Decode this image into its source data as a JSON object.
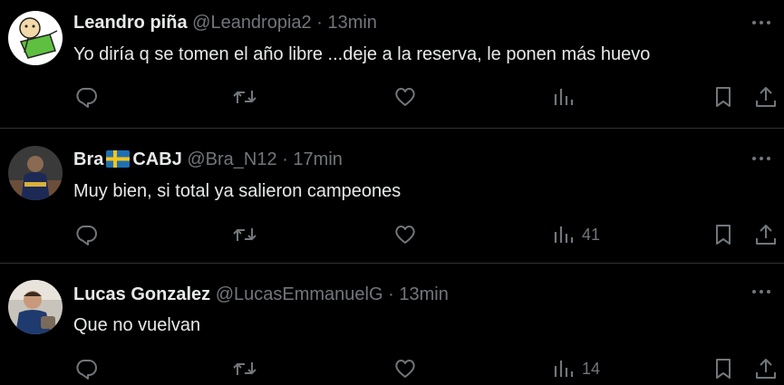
{
  "colors": {
    "background": "#000000",
    "text_primary": "#e7e9ea",
    "text_secondary": "#71767b",
    "divider": "#2f3336"
  },
  "tweets": [
    {
      "name": "Leandro piña",
      "handle": "@Leandropia2",
      "separator": "·",
      "time": "13min",
      "text": "Yo diría q se tomen el año libre ...deje a la reserva, le ponen más huevo",
      "views": "",
      "avatar_icon": "cartoon-avatar"
    },
    {
      "name_prefix": "Bra",
      "flag_icon": "sweden-flag-emoji",
      "name_suffix": "CABJ",
      "handle": "@Bra_N12",
      "separator": "·",
      "time": "17min",
      "text": "Muy bien, si total ya salieron campeones",
      "views": "41",
      "avatar_icon": "player-photo-avatar"
    },
    {
      "name": "Lucas Gonzalez",
      "handle": "@LucasEmmanuelG",
      "separator": "·",
      "time": "13min",
      "text": "Que no vuelvan",
      "views": "14",
      "avatar_icon": "person-photo-avatar"
    }
  ],
  "actions": [
    "reply-icon",
    "retweet-icon",
    "like-icon",
    "views-icon",
    "bookmark-icon",
    "share-icon"
  ]
}
